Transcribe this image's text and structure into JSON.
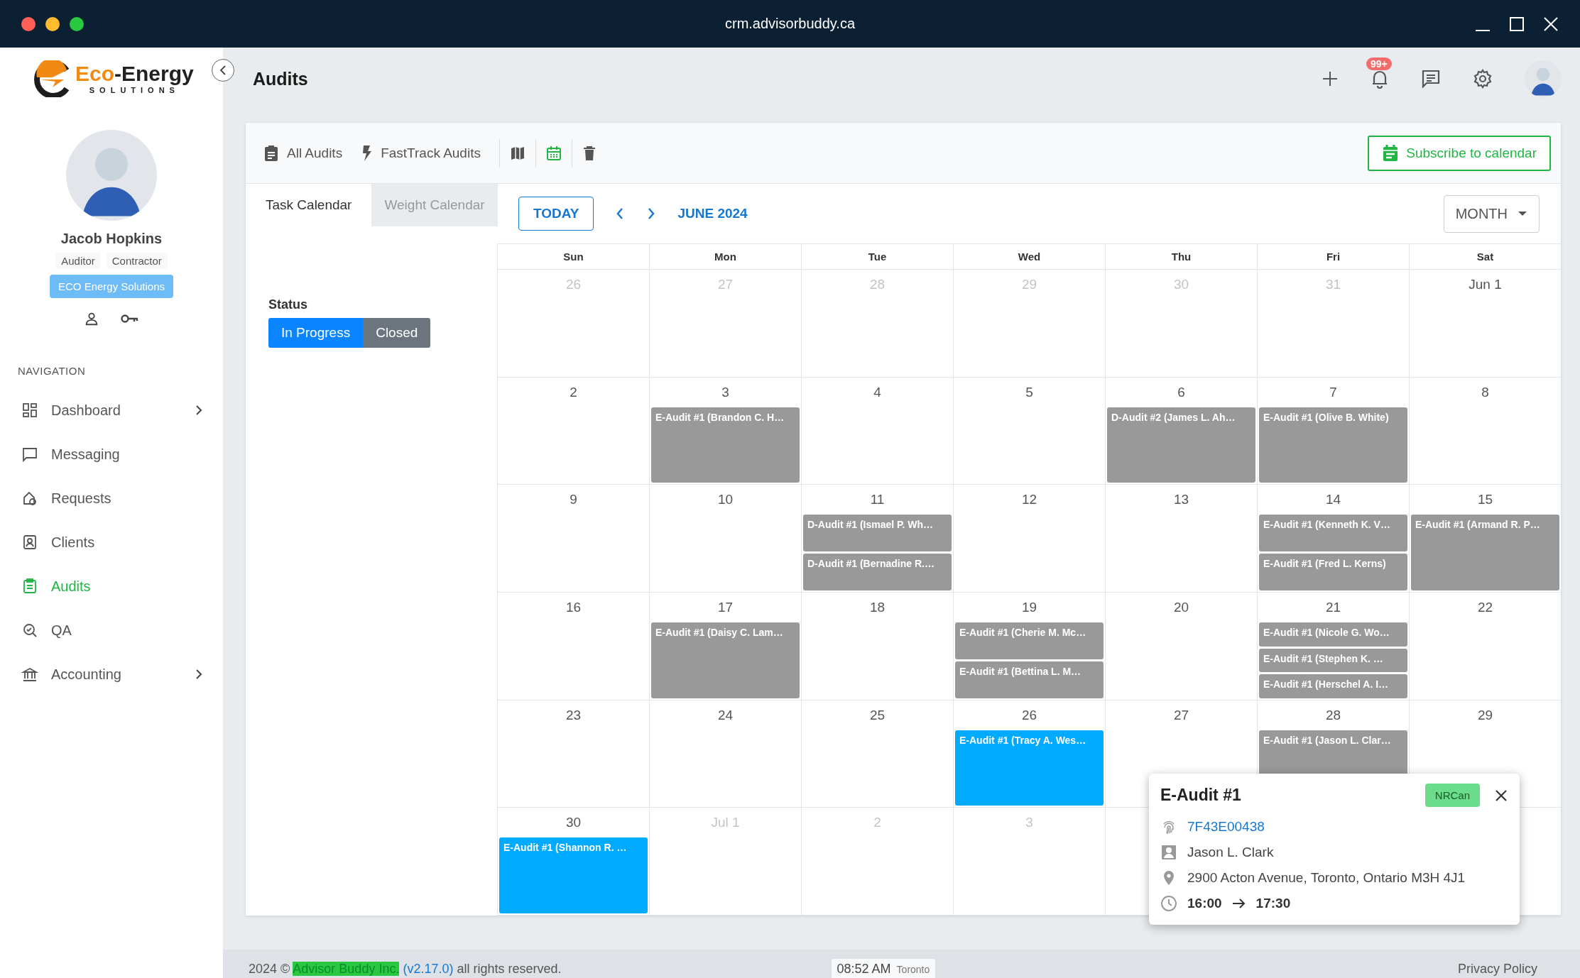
{
  "window": {
    "title": "crm.advisorbuddy.ca"
  },
  "logo": {
    "accent": "Eco",
    "rest": "-Energy",
    "tagline": "SOLUTIONS"
  },
  "header": {
    "title": "Audits",
    "notification_count": "99+"
  },
  "profile": {
    "name": "Jacob Hopkins",
    "roles": [
      "Auditor",
      "Contractor"
    ],
    "company": "ECO Energy Solutions"
  },
  "navigation": {
    "heading": "NAVIGATION",
    "items": [
      {
        "label": "Dashboard",
        "kind": "dashboard",
        "selected": false,
        "has_submenu": true
      },
      {
        "label": "Messaging",
        "kind": "messaging",
        "selected": false,
        "has_submenu": false
      },
      {
        "label": "Requests",
        "kind": "requests",
        "selected": false,
        "has_submenu": false
      },
      {
        "label": "Clients",
        "kind": "clients",
        "selected": false,
        "has_submenu": false
      },
      {
        "label": "Audits",
        "kind": "audits",
        "selected": true,
        "has_submenu": false
      },
      {
        "label": "QA",
        "kind": "qa",
        "selected": false,
        "has_submenu": false
      },
      {
        "label": "Accounting",
        "kind": "accounting",
        "selected": false,
        "has_submenu": true
      }
    ]
  },
  "toolbar": {
    "links": [
      {
        "label": "All Audits",
        "kind": "clipboard"
      },
      {
        "label": "FastTrack Audits",
        "kind": "bolt"
      }
    ],
    "views": [
      {
        "kind": "map",
        "selected": false
      },
      {
        "kind": "calendar",
        "selected": true
      },
      {
        "kind": "trash",
        "selected": false
      }
    ],
    "subscribe": "Subscribe to calendar"
  },
  "calendar_tabs": [
    {
      "label": "Task Calendar",
      "selected": true
    },
    {
      "label": "Weight Calendar",
      "selected": false
    }
  ],
  "status_filter": {
    "label": "Status",
    "options": [
      {
        "label": "In Progress",
        "selected": true
      },
      {
        "label": "Closed",
        "selected": false
      }
    ]
  },
  "calendar": {
    "today": "TODAY",
    "month": "JUNE 2024",
    "view": "MONTH",
    "weekdays": [
      "Sun",
      "Mon",
      "Tue",
      "Wed",
      "Thu",
      "Fri",
      "Sat"
    ],
    "weeks": [
      [
        {
          "label": "26",
          "muted": true
        },
        {
          "label": "27",
          "muted": true
        },
        {
          "label": "28",
          "muted": true
        },
        {
          "label": "29",
          "muted": true
        },
        {
          "label": "30",
          "muted": true
        },
        {
          "label": "31",
          "muted": true
        },
        {
          "label": "Jun 1",
          "muted": false
        }
      ],
      [
        {
          "label": "2",
          "muted": false
        },
        {
          "label": "3",
          "muted": false,
          "events": [
            {
              "title": "E-Audit #1 (Brandon C. H…",
              "color": "#999999"
            }
          ]
        },
        {
          "label": "4",
          "muted": false
        },
        {
          "label": "5",
          "muted": false
        },
        {
          "label": "6",
          "muted": false,
          "events": [
            {
              "title": "D-Audit #2 (James L. Ah…",
              "color": "#999999"
            }
          ]
        },
        {
          "label": "7",
          "muted": false,
          "events": [
            {
              "title": "E-Audit #1 (Olive B. White)",
              "color": "#999999"
            }
          ]
        },
        {
          "label": "8",
          "muted": false
        }
      ],
      [
        {
          "label": "9",
          "muted": false
        },
        {
          "label": "10",
          "muted": false
        },
        {
          "label": "11",
          "muted": false,
          "events": [
            {
              "title": "D-Audit #1 (Ismael P. Wh…",
              "color": "#999999"
            },
            {
              "title": "D-Audit #1 (Bernadine R.…",
              "color": "#999999"
            }
          ]
        },
        {
          "label": "12",
          "muted": false
        },
        {
          "label": "13",
          "muted": false
        },
        {
          "label": "14",
          "muted": false,
          "events": [
            {
              "title": "E-Audit #1 (Kenneth K. V…",
              "color": "#999999"
            },
            {
              "title": "E-Audit #1 (Fred L. Kerns)",
              "color": "#999999"
            }
          ]
        },
        {
          "label": "15",
          "muted": false,
          "events": [
            {
              "title": "E-Audit #1 (Armand R. P…",
              "color": "#999999"
            }
          ]
        }
      ],
      [
        {
          "label": "16",
          "muted": false
        },
        {
          "label": "17",
          "muted": false,
          "events": [
            {
              "title": "E-Audit #1 (Daisy C. Lam…",
              "color": "#999999"
            }
          ]
        },
        {
          "label": "18",
          "muted": false
        },
        {
          "label": "19",
          "muted": false,
          "events": [
            {
              "title": "E-Audit #1 (Cherie M. Mc…",
              "color": "#999999"
            },
            {
              "title": "E-Audit #1 (Bettina L. M…",
              "color": "#999999"
            }
          ]
        },
        {
          "label": "20",
          "muted": false
        },
        {
          "label": "21",
          "muted": false,
          "events": [
            {
              "title": "E-Audit #1 (Nicole G. Wo…",
              "color": "#999999"
            },
            {
              "title": "E-Audit #1 (Stephen K. …",
              "color": "#999999"
            },
            {
              "title": "E-Audit #1 (Herschel A. I…",
              "color": "#999999"
            }
          ]
        },
        {
          "label": "22",
          "muted": false
        }
      ],
      [
        {
          "label": "23",
          "muted": false
        },
        {
          "label": "24",
          "muted": false
        },
        {
          "label": "25",
          "muted": false
        },
        {
          "label": "26",
          "muted": false,
          "events": [
            {
              "title": "E-Audit #1 (Tracy A. Wes…",
              "color": "#00aaff"
            }
          ]
        },
        {
          "label": "27",
          "muted": false
        },
        {
          "label": "28",
          "muted": false,
          "events": [
            {
              "title": "E-Audit #1 (Jason L. Clar…",
              "color": "#999999"
            }
          ]
        },
        {
          "label": "29",
          "muted": false
        }
      ],
      [
        {
          "label": "30",
          "muted": false,
          "events": [
            {
              "title": "E-Audit #1 (Shannon R. …",
              "color": "#00aaff"
            }
          ]
        },
        {
          "label": "Jul 1",
          "muted": true
        },
        {
          "label": "2",
          "muted": true
        },
        {
          "label": "3",
          "muted": true
        }
      ]
    ]
  },
  "popup": {
    "title": "E-Audit #1",
    "tag": "NRCan",
    "reference": "7F43E00438",
    "client": "Jason L. Clark",
    "address": "2900 Acton Avenue, Toronto, Ontario M3H 4J1",
    "start": "16:00",
    "end": "17:30"
  },
  "footer": {
    "prefix": "2024 ©",
    "company": "Advisor Buddy Inc.",
    "version": "(v2.17.0)",
    "suffix": "all rights reserved.",
    "time": "08:52 AM",
    "city": "Toronto",
    "privacy": "Privacy Policy"
  }
}
